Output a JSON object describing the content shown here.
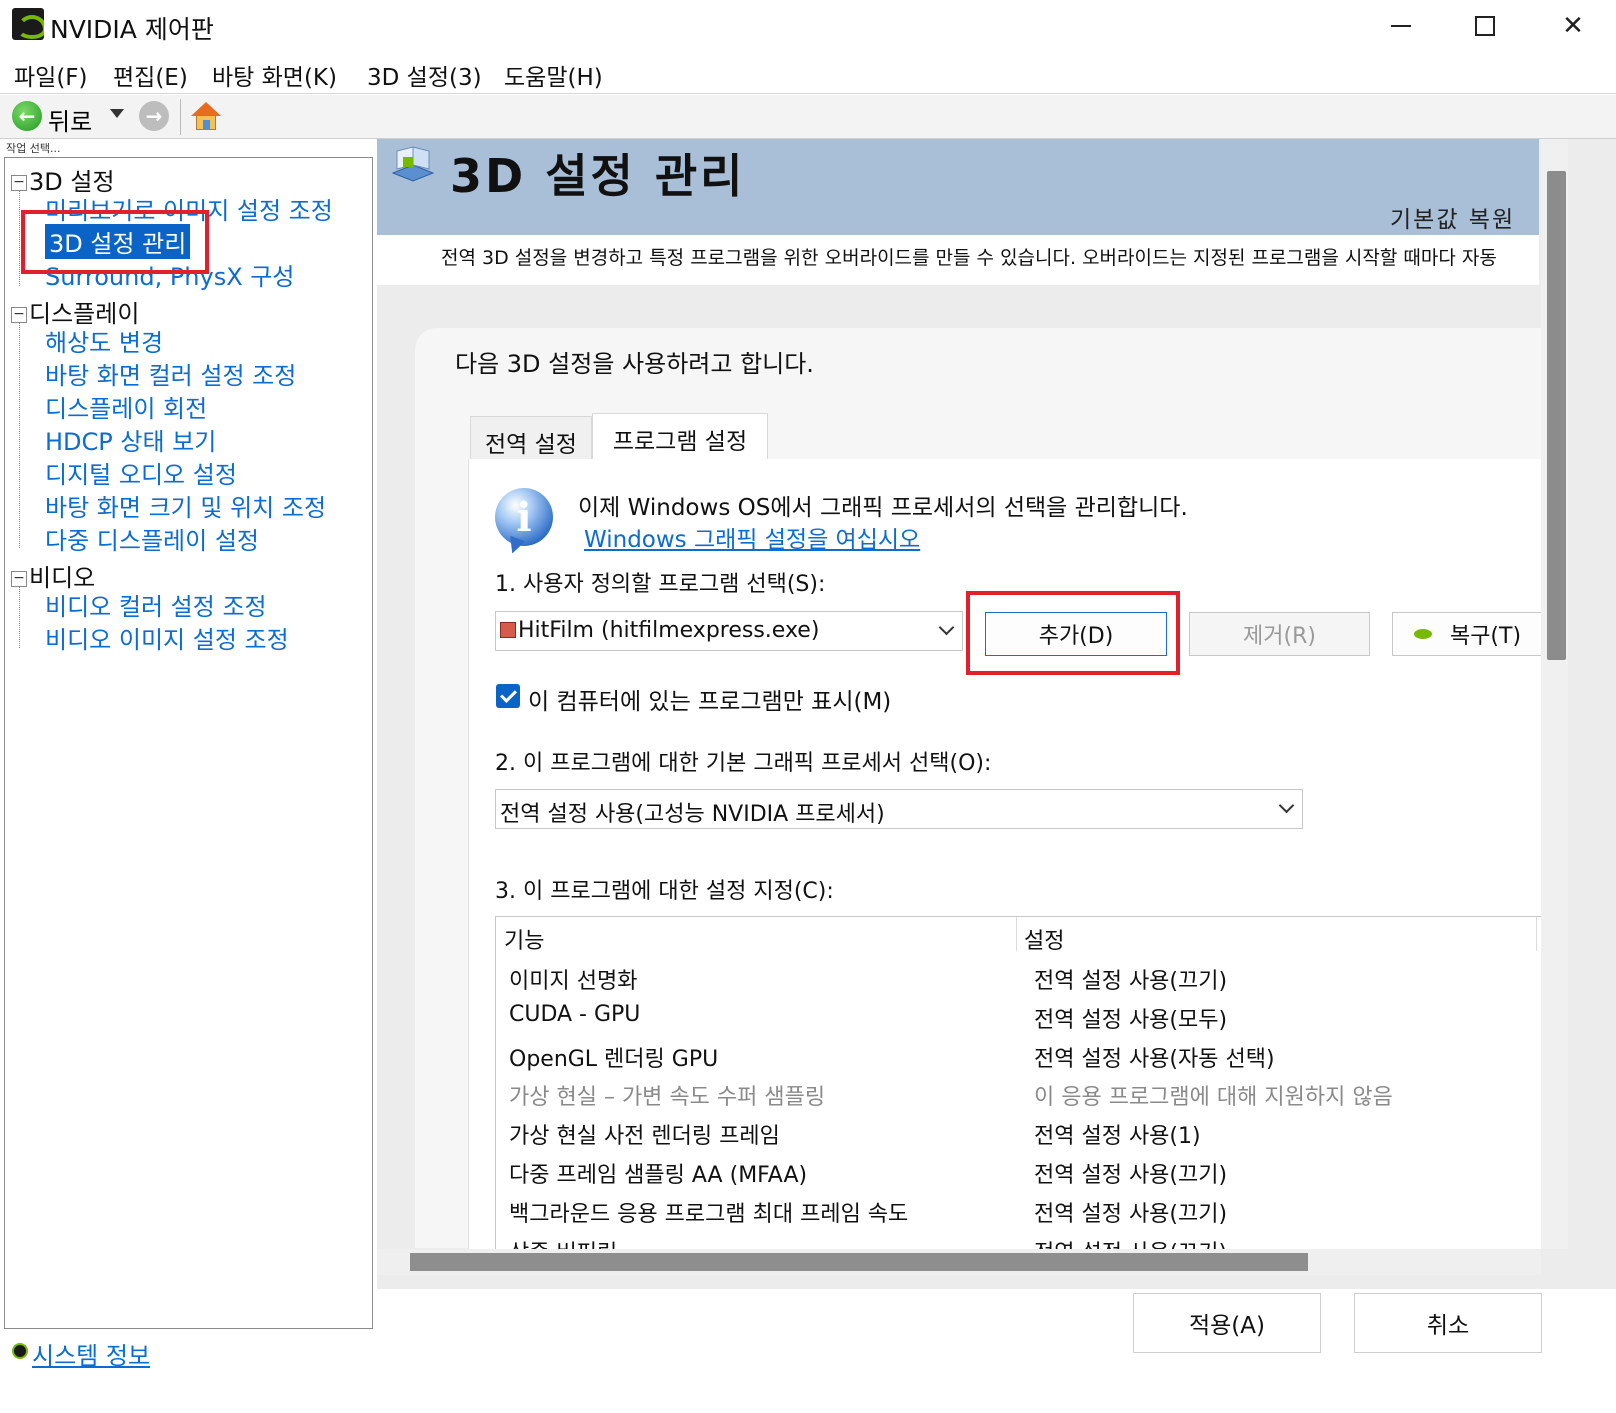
{
  "window": {
    "title": "NVIDIA 제어판"
  },
  "menu": [
    "파일(F)",
    "편집(E)",
    "바탕 화면(K)",
    "3D 설정(3)",
    "도움말(H)"
  ],
  "toolbar": {
    "back_label": "뒤로"
  },
  "left": {
    "caption": "작업 선택...",
    "groups": [
      {
        "label": "3D 설정",
        "items": [
          "미리보기로 이미지 설정 조정",
          "3D 설정 관리",
          "Surround, PhysX 구성"
        ]
      },
      {
        "label": "디스플레이",
        "items": [
          "해상도 변경",
          "바탕 화면 컬러 설정 조정",
          "디스플레이 회전",
          "HDCP 상태 보기",
          "디지털 오디오 설정",
          "바탕 화면 크기 및 위치 조정",
          "다중 디스플레이 설정"
        ]
      },
      {
        "label": "비디오",
        "items": [
          "비디오 컬러 설정 조정",
          "비디오 이미지 설정 조정"
        ]
      }
    ],
    "selected": "3D 설정 관리",
    "system_info": "시스템 정보"
  },
  "header": {
    "title": "3D 설정 관리",
    "restore_default": "기본값 복원",
    "description": "전역 3D 설정을 변경하고 특정 프로그램을 위한 오버라이드를 만들 수 있습니다. 오버라이드는 지정된 프로그램을 시작할 때마다 자동"
  },
  "main": {
    "intro": "다음 3D 설정을 사용하려고 합니다.",
    "tabs": [
      "전역 설정",
      "프로그램 설정"
    ],
    "active_tab": "프로그램 설정",
    "info_text": "이제 Windows OS에서 그래픽 프로세서의 선택을 관리합니다.",
    "info_link": "Windows 그래픽 설정을 여십시오",
    "step1_label": "1. 사용자 정의할 프로그램 선택(S):",
    "program_selected": "HitFilm (hitfilmexpress.exe)",
    "add_button": "추가(D)",
    "remove_button": "제거(R)",
    "restore_button": "복구(T)",
    "checkbox_label": "이 컴퓨터에 있는 프로그램만 표시(M)",
    "checkbox_checked": true,
    "step2_label": "2. 이 프로그램에 대한 기본 그래픽 프로세서 선택(O):",
    "gpu_selected": "전역 설정 사용(고성능 NVIDIA 프로세서)",
    "step3_label": "3. 이 프로그램에 대한 설정 지정(C):",
    "table": {
      "headers": [
        "기능",
        "설정"
      ],
      "rows": [
        {
          "feature": "이미지 선명화",
          "setting": "전역 설정 사용(끄기)",
          "disabled": false
        },
        {
          "feature": "CUDA - GPU",
          "setting": "전역 설정 사용(모두)",
          "disabled": false
        },
        {
          "feature": "OpenGL 렌더링 GPU",
          "setting": "전역 설정 사용(자동 선택)",
          "disabled": false
        },
        {
          "feature": "가상 현실 – 가변 속도 수퍼 샘플링",
          "setting": "이 응용 프로그램에 대해 지원하지 않음",
          "disabled": true
        },
        {
          "feature": "가상 현실 사전 렌더링 프레임",
          "setting": "전역 설정 사용(1)",
          "disabled": false
        },
        {
          "feature": "다중 프레임 샘플링 AA (MFAA)",
          "setting": "전역 설정 사용(끄기)",
          "disabled": false
        },
        {
          "feature": "백그라운드 응용 프로그램 최대 프레임 속도",
          "setting": "전역 설정 사용(끄기)",
          "disabled": false
        },
        {
          "feature": "삼중 버퍼링",
          "setting": "전역 설정 사용(끄기)",
          "disabled": false
        }
      ]
    }
  },
  "footer": {
    "apply": "적용(A)",
    "cancel": "취소"
  }
}
